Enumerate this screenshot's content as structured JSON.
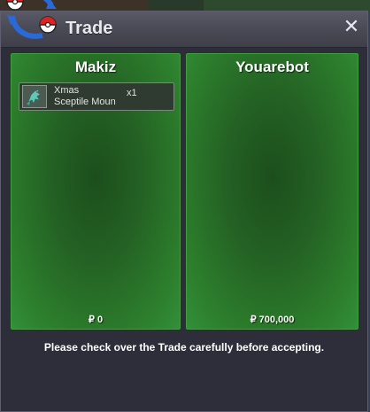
{
  "window": {
    "title": "Trade",
    "close_label": "✕"
  },
  "panels": {
    "left": {
      "player": "Makiz",
      "money": "₽ 0",
      "items": [
        {
          "name": "Xmas\nSceptile Moun",
          "qty": "x1",
          "icon": "sceptile-mount-icon"
        }
      ]
    },
    "right": {
      "player": "Youarebot",
      "money": "₽ 700,000",
      "items": []
    }
  },
  "footer": {
    "message": "Please check over the Trade carefully before accepting."
  },
  "colors": {
    "panel_green": "#2a7a2a",
    "window_bg": "#2e2d3a",
    "title_text": "#e8e8ee"
  }
}
